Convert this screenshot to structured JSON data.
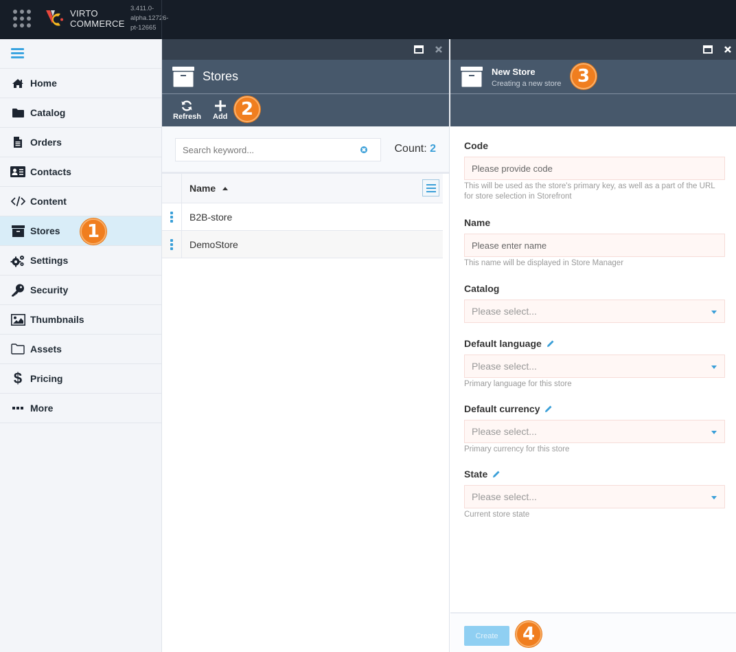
{
  "topbar": {
    "brand_line1": "VIRTO",
    "brand_line2": "COMMERCE",
    "version_line1": "3.411.0-",
    "version_line2": "alpha.12726-",
    "version_line3": "pt-12665"
  },
  "sidebar": {
    "items": [
      {
        "label": "Home",
        "icon": "home-icon"
      },
      {
        "label": "Catalog",
        "icon": "folder-icon"
      },
      {
        "label": "Orders",
        "icon": "document-icon"
      },
      {
        "label": "Contacts",
        "icon": "contact-card-icon"
      },
      {
        "label": "Content",
        "icon": "code-icon"
      },
      {
        "label": "Stores",
        "icon": "archive-box-icon",
        "active": true
      },
      {
        "label": "Settings",
        "icon": "gears-icon"
      },
      {
        "label": "Security",
        "icon": "key-icon"
      },
      {
        "label": "Thumbnails",
        "icon": "image-icon"
      },
      {
        "label": "Assets",
        "icon": "folder-outline-icon"
      },
      {
        "label": "Pricing",
        "icon": "dollar-icon"
      },
      {
        "label": "More",
        "icon": "ellipsis-icon"
      }
    ]
  },
  "steps": [
    "1",
    "2",
    "3",
    "4"
  ],
  "stores_blade": {
    "title": "Stores",
    "toolbar": {
      "refresh_label": "Refresh",
      "add_label": "Add"
    },
    "search": {
      "placeholder": "Search keyword...",
      "value": ""
    },
    "count_label": "Count:",
    "count_value": "2",
    "grid": {
      "column_name": "Name",
      "sort": "ascending",
      "rows": [
        {
          "name": "B2B-store"
        },
        {
          "name": "DemoStore"
        }
      ]
    }
  },
  "new_store_blade": {
    "title": "New Store",
    "subtitle": "Creating a new store",
    "fields": {
      "code": {
        "label": "Code",
        "placeholder": "Please provide code",
        "value": "",
        "hint": "This will be used as the store's primary key, as well as a part of the URL for store selection in Storefront"
      },
      "name": {
        "label": "Name",
        "placeholder": "Please enter name",
        "value": "",
        "hint": "This name will be displayed in Store Manager"
      },
      "catalog": {
        "label": "Catalog",
        "placeholder": "Please select..."
      },
      "default_language": {
        "label": "Default language",
        "placeholder": "Please select...",
        "hint": "Primary language for this store"
      },
      "default_currency": {
        "label": "Default currency",
        "placeholder": "Please select...",
        "hint": "Primary currency for this store"
      },
      "state": {
        "label": "State",
        "placeholder": "Please select...",
        "hint": "Current store state"
      }
    },
    "create_label": "Create"
  },
  "colors": {
    "accent": "#3a9fd8",
    "topbar": "#161d27",
    "blade_header": "#47586b",
    "step_badge": "#f07e1f",
    "active_nav": "#d9edf8"
  }
}
